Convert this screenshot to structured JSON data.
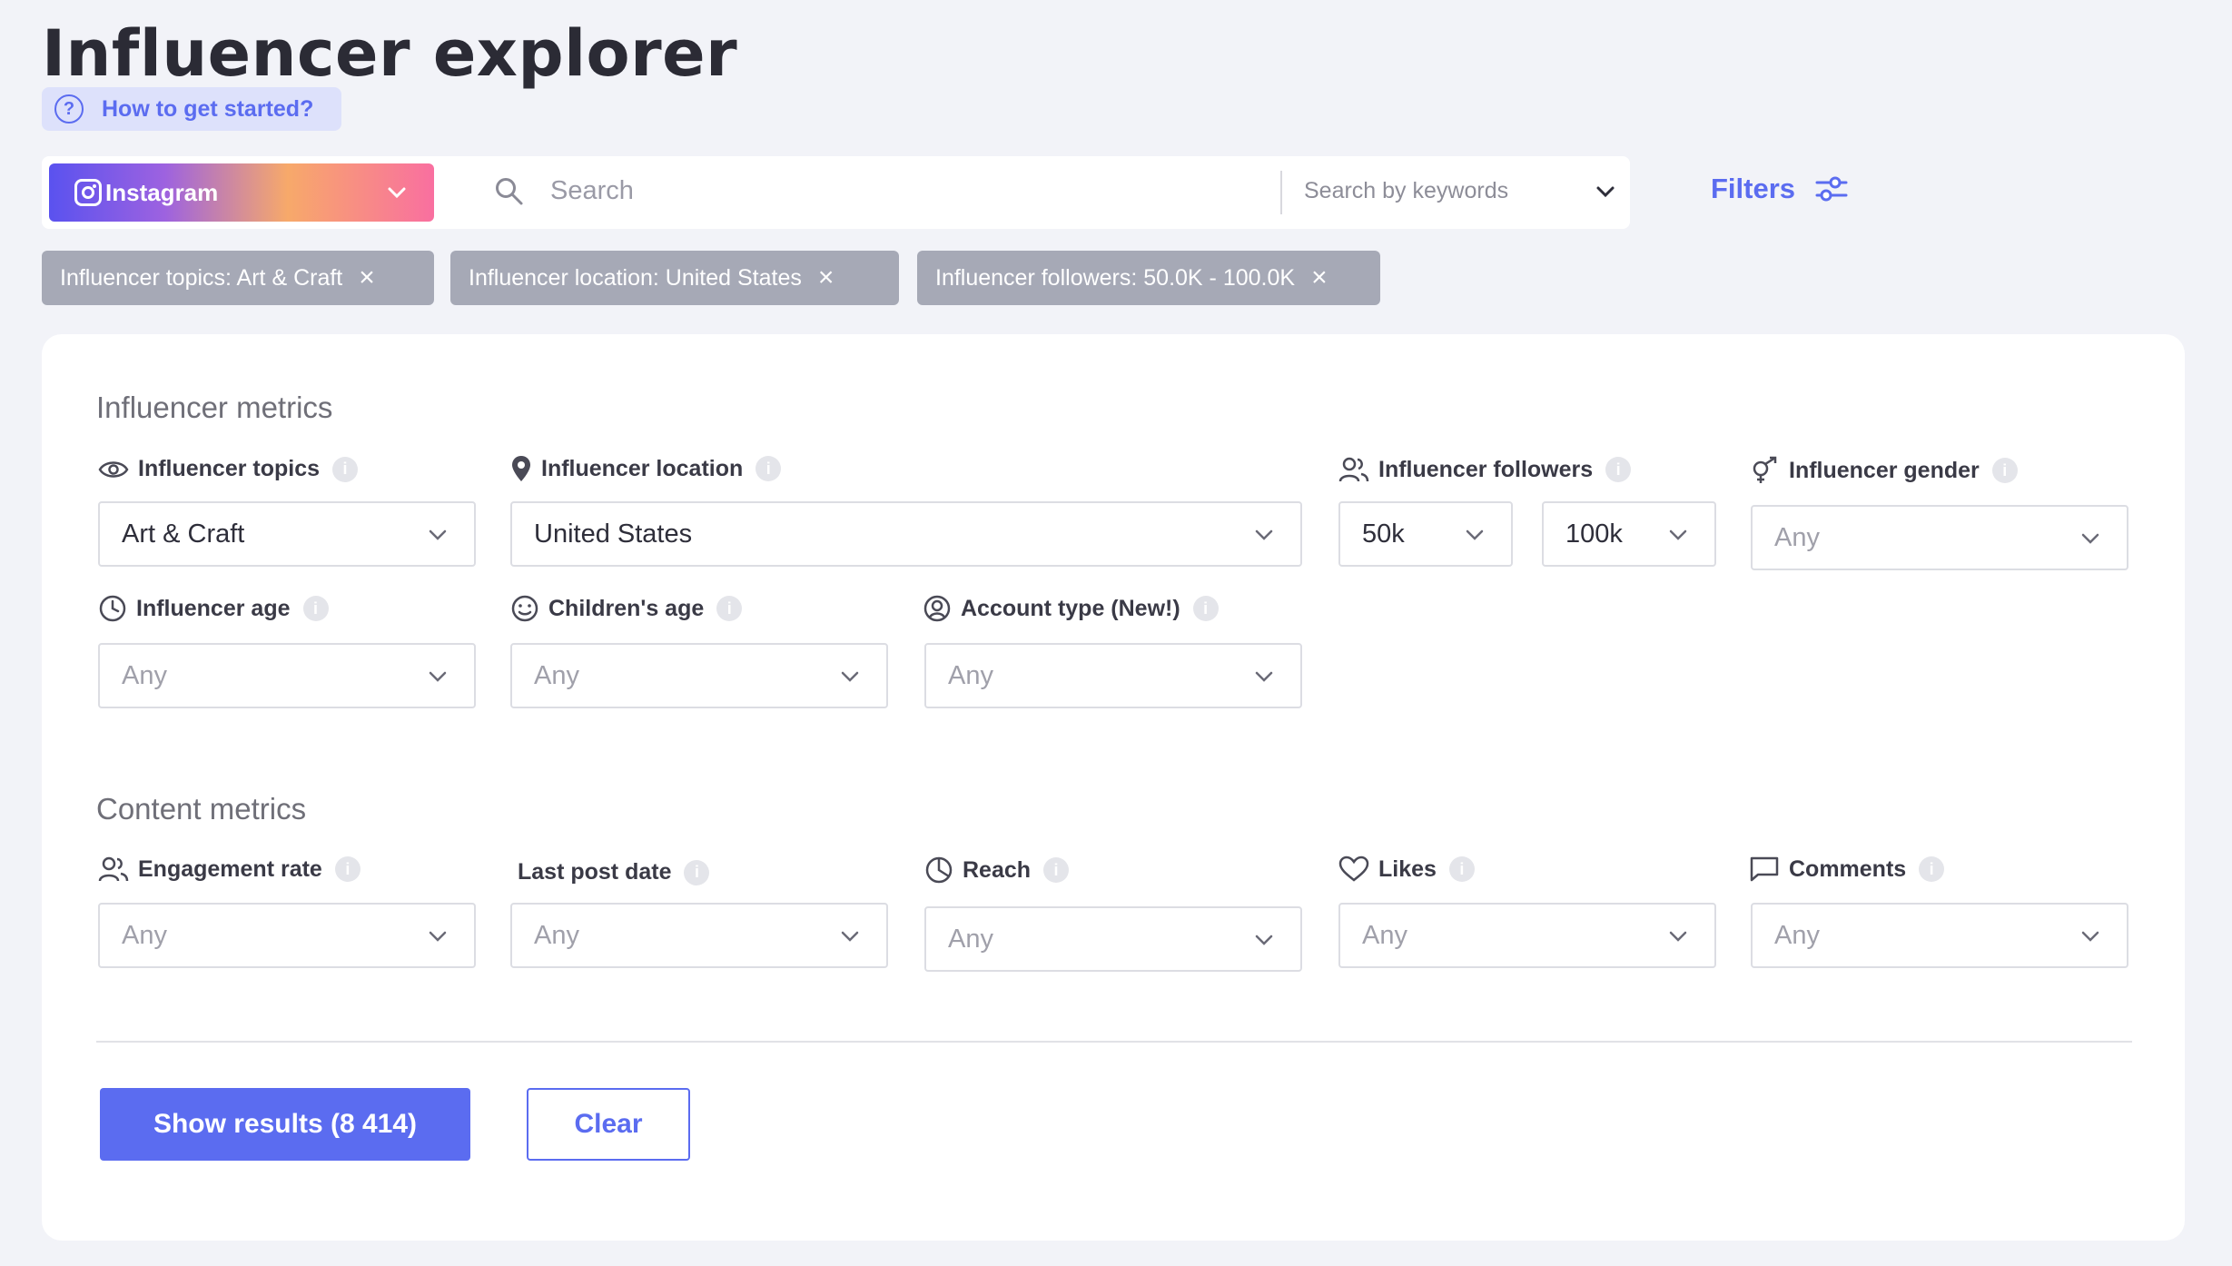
{
  "header": {
    "title": "Influencer explorer",
    "help_link": "How to get started?"
  },
  "searchbar": {
    "platform": "Instagram",
    "search_placeholder": "Search",
    "keywords_mode": "Search by keywords"
  },
  "filters_label": "Filters",
  "chips": [
    {
      "label": "Influencer topics: Art & Craft"
    },
    {
      "label": "Influencer location: United States"
    },
    {
      "label": "Influencer followers: 50.0K - 100.0K"
    }
  ],
  "influencer_metrics": {
    "title": "Influencer metrics",
    "topics": {
      "label": "Influencer topics",
      "value": "Art & Craft",
      "icon": "eye-icon"
    },
    "location": {
      "label": "Influencer location",
      "value": "United States",
      "icon": "location-pin-icon"
    },
    "followers": {
      "label": "Influencer followers",
      "min": "50k",
      "max": "100k",
      "icon": "users-icon"
    },
    "gender": {
      "label": "Influencer gender",
      "value": "Any",
      "icon": "gender-icon"
    },
    "age": {
      "label": "Influencer age",
      "value": "Any",
      "icon": "clock-icon"
    },
    "children_age": {
      "label": "Children's age",
      "value": "Any",
      "icon": "smiley-icon"
    },
    "account_type": {
      "label": "Account type (New!)",
      "value": "Any",
      "icon": "user-circle-icon"
    }
  },
  "content_metrics": {
    "title": "Content metrics",
    "engagement": {
      "label": "Engagement rate",
      "value": "Any",
      "icon": "users-icon"
    },
    "last_post": {
      "label": "Last post date",
      "value": "Any"
    },
    "reach": {
      "label": "Reach",
      "value": "Any",
      "icon": "pie-chart-icon"
    },
    "likes": {
      "label": "Likes",
      "value": "Any",
      "icon": "heart-icon"
    },
    "comments": {
      "label": "Comments",
      "value": "Any",
      "icon": "comment-icon"
    }
  },
  "info_glyph": "i",
  "chip_close_glyph": "×",
  "help_glyph": "?",
  "actions": {
    "show_results": "Show results (8 414)",
    "clear": "Clear"
  },
  "colors": {
    "accent": "#5b6cf0",
    "chip_bg": "#a6a9b6",
    "background": "#f2f3f8"
  }
}
